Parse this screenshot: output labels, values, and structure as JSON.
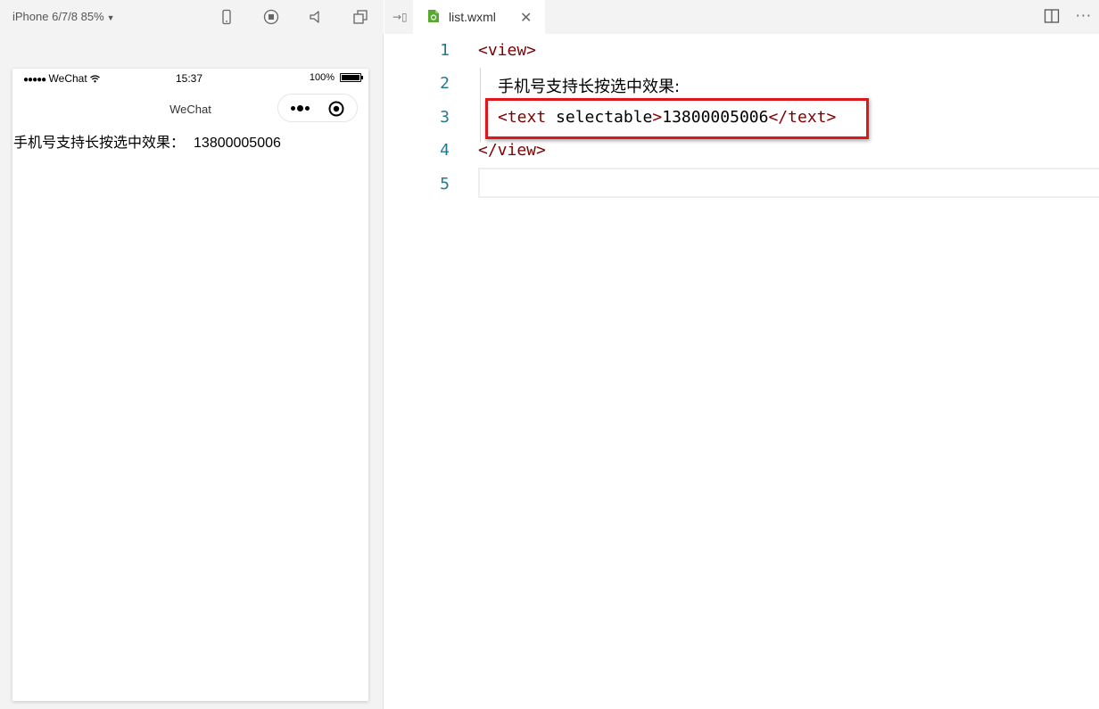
{
  "simulator": {
    "device_label": "iPhone 6/7/8 85%",
    "toolbar_icons": [
      "phone-icon",
      "record-icon",
      "volume-icon",
      "window-icon"
    ],
    "status_bar": {
      "carrier": "WeChat",
      "time": "15:37",
      "battery": "100%"
    },
    "nav_title": "WeChat",
    "page": {
      "label": "手机号支持长按选中效果：",
      "phone_number": "13800005006"
    }
  },
  "editor": {
    "tab": {
      "file_name": "list.wxml"
    },
    "lines": [
      {
        "number": "1",
        "open_tag": "<view>"
      },
      {
        "number": "2",
        "text": "手机号支持长按选中效果:"
      },
      {
        "number": "3",
        "tag_open": "<text",
        "attr": " selectable",
        "tag_close": ">",
        "content": "13800005006",
        "end_tag": "</text>"
      },
      {
        "number": "4",
        "close_tag": "</view>"
      },
      {
        "number": "5"
      }
    ],
    "highlight_color": "#e0161d"
  }
}
